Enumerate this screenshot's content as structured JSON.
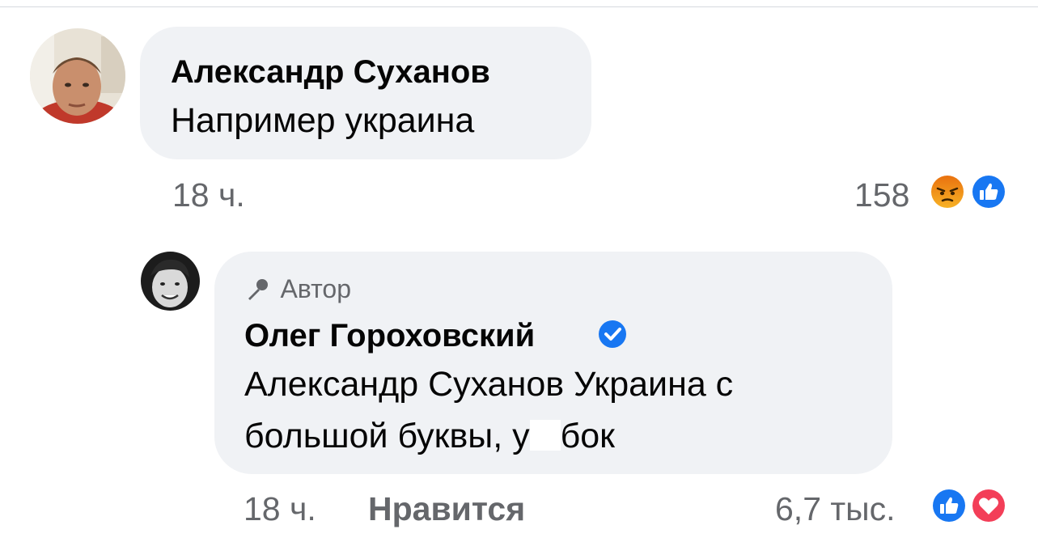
{
  "comments": [
    {
      "author": "Александр Суханов",
      "text": "Например украина",
      "time": "18 ч.",
      "reaction_count": "158",
      "reactions": [
        "angry-icon",
        "like-icon"
      ]
    },
    {
      "badge": "Автор",
      "author": "Олег Гороховский",
      "verified": true,
      "text_line1": "Александр Суханов Украина с",
      "text_line2_before": "большой буквы, у",
      "text_line2_after": "бок",
      "time": "18 ч.",
      "like_action": "Нравится",
      "reaction_count": "6,7 тыс.",
      "reactions": [
        "like-icon",
        "love-icon"
      ]
    }
  ],
  "colors": {
    "bubble": "#f0f2f5",
    "meta_text": "#65676b",
    "like_blue": "#1877f2",
    "love_red": "#f33e58",
    "angry_top": "#e9710f",
    "angry_bottom": "#f7b125"
  }
}
